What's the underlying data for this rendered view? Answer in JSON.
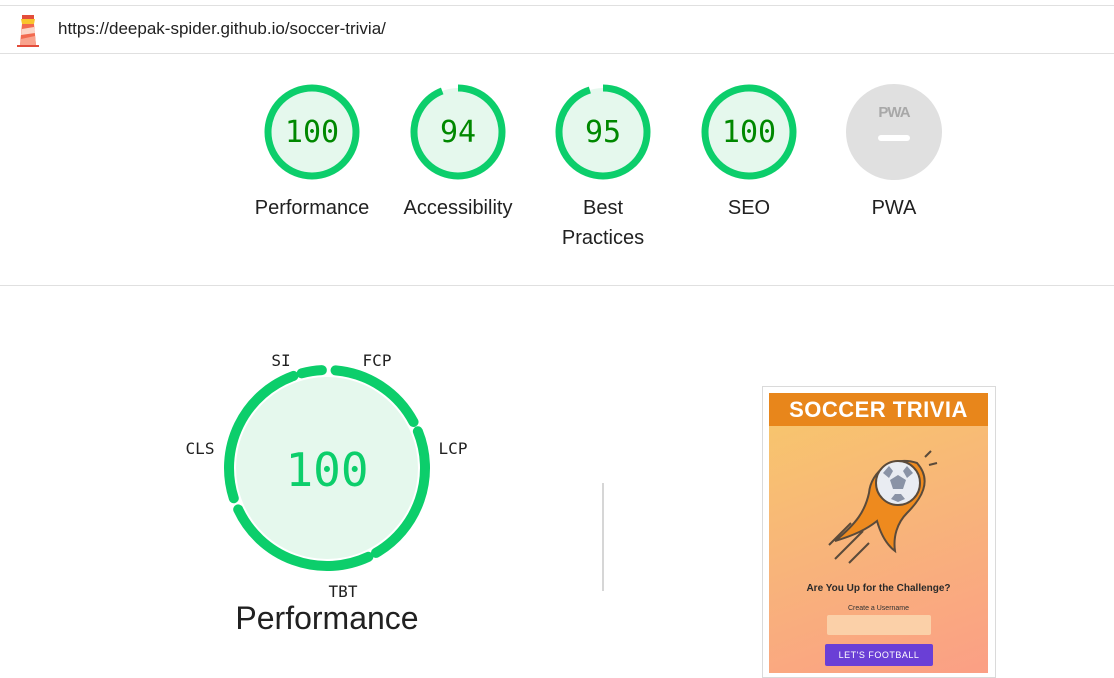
{
  "header": {
    "url": "https://deepak-spider.github.io/soccer-trivia/",
    "logo_icon": "lighthouse-icon"
  },
  "colors": {
    "pass": "#0cce6b",
    "pass_fill": "#e5f8ed",
    "pass_text": "#008800",
    "pwa_gray": "#e0e0e0",
    "thumb_banner": "#e8861b",
    "thumb_button": "#6a3fd6"
  },
  "scores": [
    {
      "label": "Performance",
      "value": "100",
      "fraction": 1.0
    },
    {
      "label": "Accessibility",
      "value": "94",
      "fraction": 0.94
    },
    {
      "label": "Best Practices",
      "value": "95",
      "fraction": 0.95
    },
    {
      "label": "SEO",
      "value": "100",
      "fraction": 1.0
    },
    {
      "label": "PWA",
      "badge": "PWA"
    }
  ],
  "performance": {
    "score": "100",
    "title": "Performance",
    "metrics": [
      "SI",
      "FCP",
      "LCP",
      "TBT",
      "CLS"
    ]
  },
  "thumbnail": {
    "banner": "SOCCER TRIVIA",
    "art_icon": "flaming-soccer-ball-icon",
    "challenge": "Are You Up for the Challenge?",
    "username_label": "Create a Username",
    "button": "LET'S FOOTBALL"
  }
}
